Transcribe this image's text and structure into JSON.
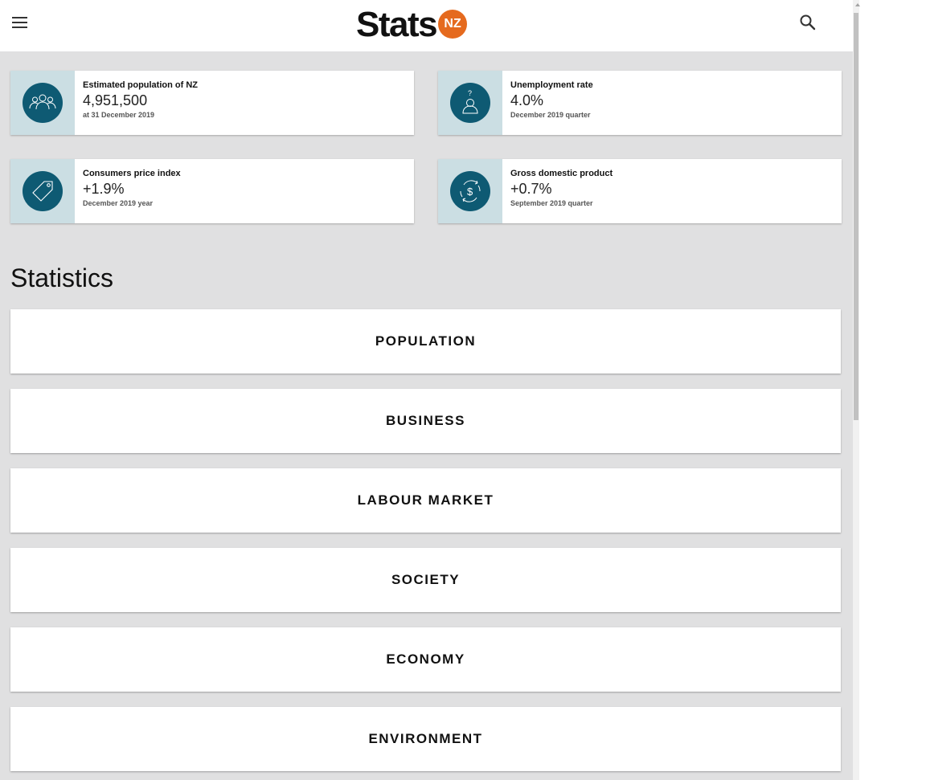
{
  "header": {
    "logo_text": "Stats",
    "logo_badge": "NZ",
    "brand_color": "#e56a1e",
    "menu_icon": "hamburger-menu-icon",
    "search_icon": "search-icon"
  },
  "stats": [
    {
      "title": "Estimated population of NZ",
      "value": "4,951,500",
      "sub": "at 31 December 2019",
      "icon": "people-group-icon"
    },
    {
      "title": "Unemployment rate",
      "value": "4.0%",
      "sub": "December 2019 quarter",
      "icon": "person-question-icon"
    },
    {
      "title": "Consumers price index",
      "value": "+1.9%",
      "sub": "December 2019 year",
      "icon": "price-tag-icon"
    },
    {
      "title": "Gross domestic product",
      "value": "+0.7%",
      "sub": "September 2019 quarter",
      "icon": "dollar-cycle-icon"
    }
  ],
  "colors": {
    "icon_circle": "#0e5a73",
    "icon_box": "#cbdee3",
    "page_bg": "#e0e0e1"
  },
  "statistics": {
    "title": "Statistics",
    "categories": [
      "POPULATION",
      "BUSINESS",
      "LABOUR MARKET",
      "SOCIETY",
      "ECONOMY",
      "ENVIRONMENT"
    ]
  }
}
